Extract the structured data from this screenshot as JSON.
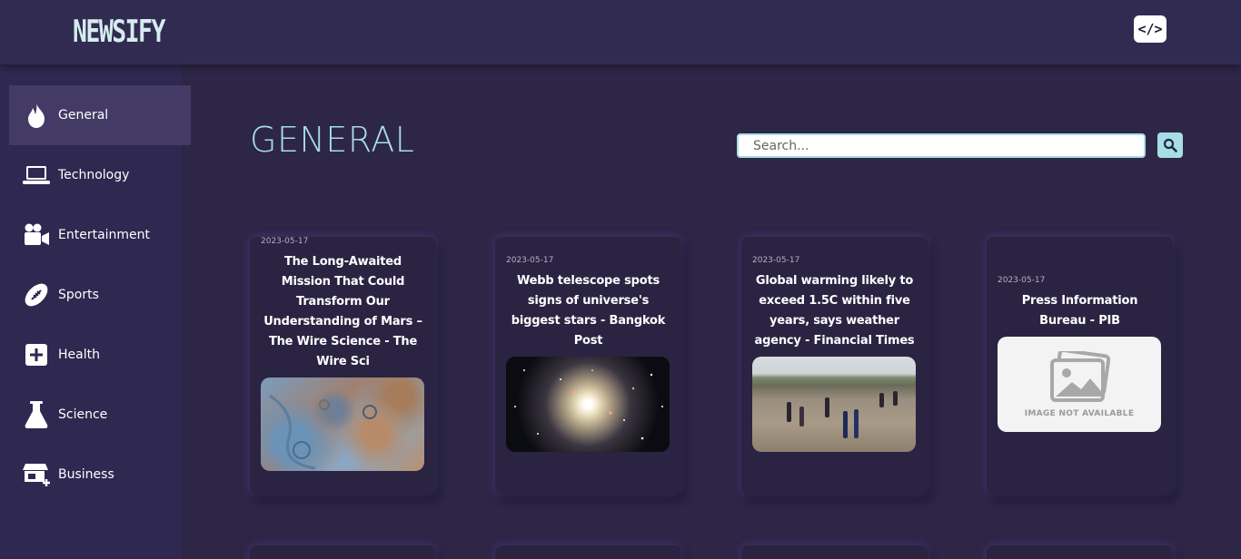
{
  "header": {
    "logo": "NEWSIFY",
    "code_button": "</>"
  },
  "sidebar": {
    "items": [
      {
        "label": "General",
        "icon": "flame-icon",
        "active": true
      },
      {
        "label": "Technology",
        "icon": "laptop-icon",
        "active": false
      },
      {
        "label": "Entertainment",
        "icon": "video-camera-icon",
        "active": false
      },
      {
        "label": "Sports",
        "icon": "football-icon",
        "active": false
      },
      {
        "label": "Health",
        "icon": "plus-square-icon",
        "active": false
      },
      {
        "label": "Science",
        "icon": "flask-icon",
        "active": false
      },
      {
        "label": "Business",
        "icon": "shop-icon",
        "active": false
      }
    ]
  },
  "main": {
    "title": "GENERAL",
    "search": {
      "placeholder": "Search...",
      "value": ""
    }
  },
  "cards": [
    {
      "date": "2023-05-17",
      "title": "The Long-Awaited Mission That Could Transform Our Understanding of Mars – The Wire Science - The Wire Sci",
      "image": "mars-surface"
    },
    {
      "date": "2023-05-17",
      "title": "Webb telescope spots signs of universe's biggest stars - Bangkok Post",
      "image": "star-cluster"
    },
    {
      "date": "2023-05-17",
      "title": "Global warming likely to exceed 1.5C within five years, says weather agency - Financial Times",
      "image": "flood-people"
    },
    {
      "date": "2023-05-17",
      "title": "Press Information Bureau - PIB",
      "image": "not-available",
      "image_text": "IMAGE NOT AVAILABLE"
    }
  ],
  "colors": {
    "background": "#2d2647",
    "accent": "#a9dde6",
    "card": "#2a2342",
    "active_nav": "#433b66"
  }
}
